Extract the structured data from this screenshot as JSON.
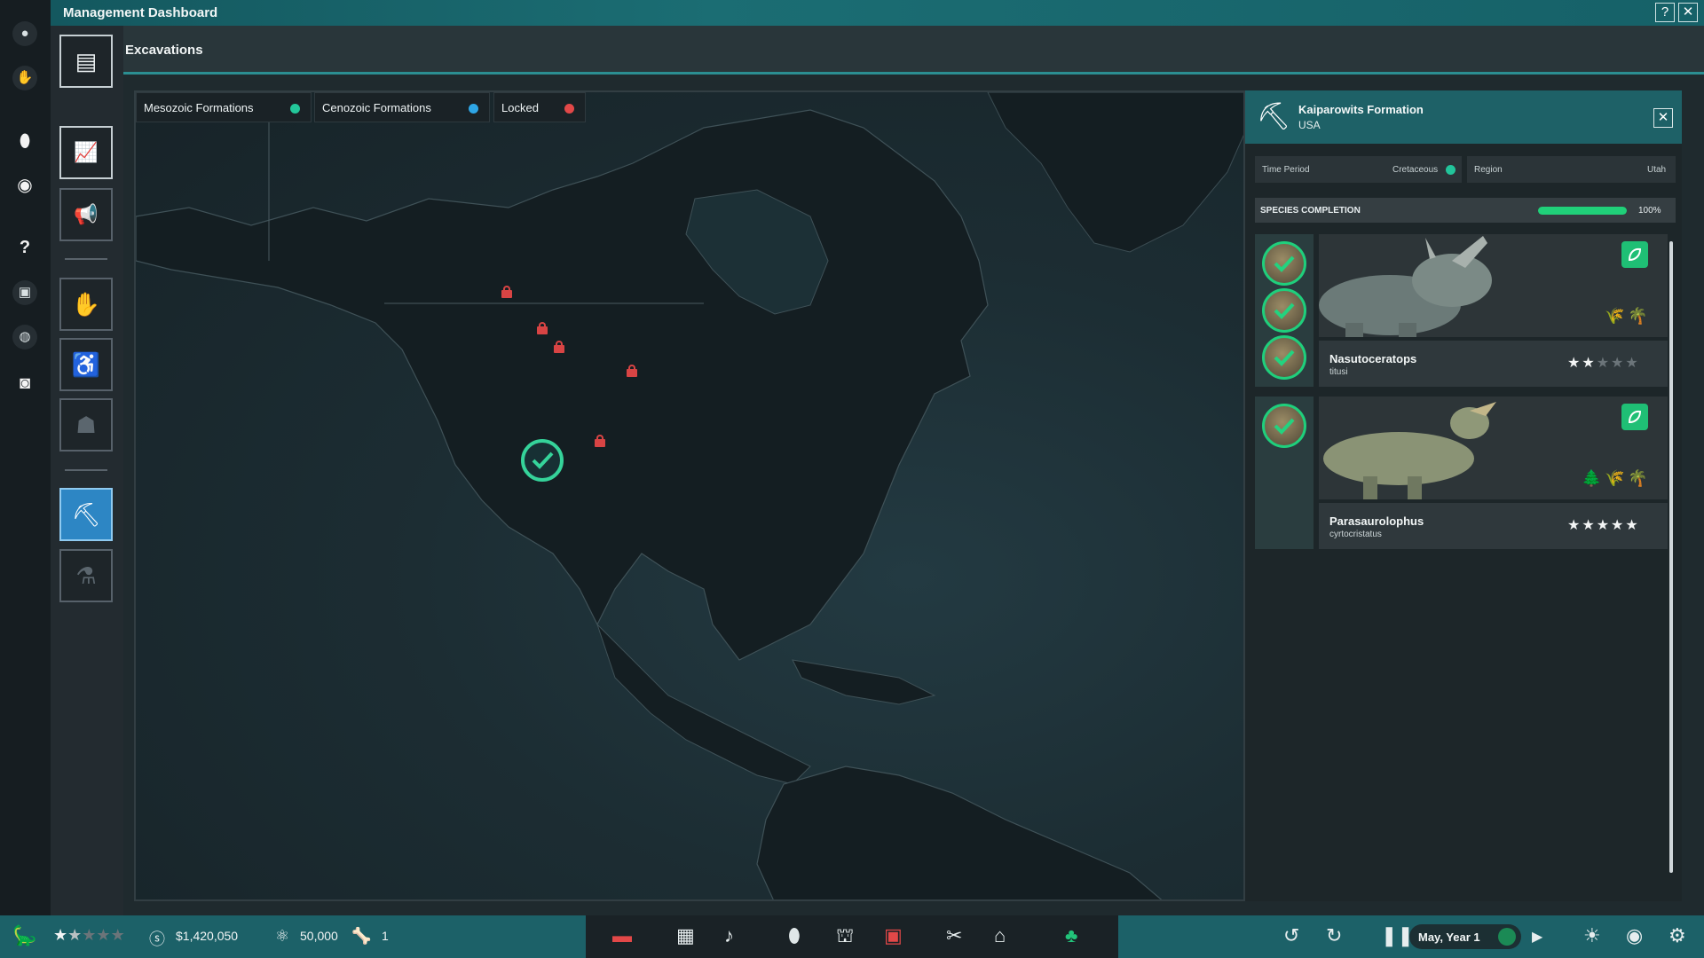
{
  "window": {
    "title": "Management Dashboard",
    "help_glyph": "?",
    "close_glyph": "✕"
  },
  "rail_icons": [
    {
      "name": "egg-icon",
      "glyph": "●"
    },
    {
      "name": "paw-icon",
      "glyph": "✋"
    },
    {
      "name": "egg-highlight-icon",
      "glyph": "⬮"
    },
    {
      "name": "eye-icon",
      "glyph": "◉"
    },
    {
      "name": "help-icon",
      "glyph": "?"
    },
    {
      "name": "settings-box-icon",
      "glyph": "▣"
    },
    {
      "name": "globe-icon",
      "glyph": "◍"
    },
    {
      "name": "camera-icon",
      "glyph": "◙"
    }
  ],
  "sidebar_buttons": [
    {
      "name": "sidebar-reports-button",
      "glyph": "▤",
      "state": "on"
    },
    {
      "name": "sidebar-finance-button",
      "glyph": "📈",
      "state": "on"
    },
    {
      "name": "sidebar-marketing-button",
      "glyph": "📢",
      "state": "off"
    },
    {
      "name": "sidebar-dinosaurs-button",
      "glyph": "✋",
      "state": "off"
    },
    {
      "name": "sidebar-staff-button",
      "glyph": "♿",
      "state": "off"
    },
    {
      "name": "sidebar-guests-button",
      "glyph": "☗",
      "state": "off"
    },
    {
      "name": "sidebar-excavations-button",
      "glyph": "⛏",
      "state": "selected"
    },
    {
      "name": "sidebar-research-button",
      "glyph": "⚗",
      "state": "off"
    }
  ],
  "header": {
    "title": "Excavations"
  },
  "legend": [
    {
      "label": "Mesozoic Formations",
      "color": "#23c79a"
    },
    {
      "label": "Cenozoic Formations",
      "color": "#2ea6e6"
    },
    {
      "label": "Locked",
      "color": "#e24848"
    }
  ],
  "panel": {
    "formation": "Kaiparowits Formation",
    "country": "USA",
    "time_period_label": "Time Period",
    "time_period_value": "Cretaceous",
    "region_label": "Region",
    "region_value": "Utah",
    "completion_label": "SPECIES COMPLETION",
    "completion_pct": "100%",
    "completion_value": 1.0,
    "species": [
      {
        "name": "Nasutoceratops",
        "species": "titusi",
        "rating": 2,
        "badges": 3,
        "habitat": [
          "🌾",
          "🌴"
        ]
      },
      {
        "name": "Parasaurolophus",
        "species": "cyrtocristatus",
        "rating": 5,
        "badges": 1,
        "habitat": [
          "🌲",
          "🌾",
          "🌴"
        ]
      }
    ]
  },
  "bottom": {
    "park_rating": 1.5,
    "money": "$1,420,050",
    "science": "50,000",
    "fossils": "1",
    "date": "May, Year 1",
    "colors": {
      "bar": "#1c6168",
      "center": "#1a2226"
    }
  }
}
